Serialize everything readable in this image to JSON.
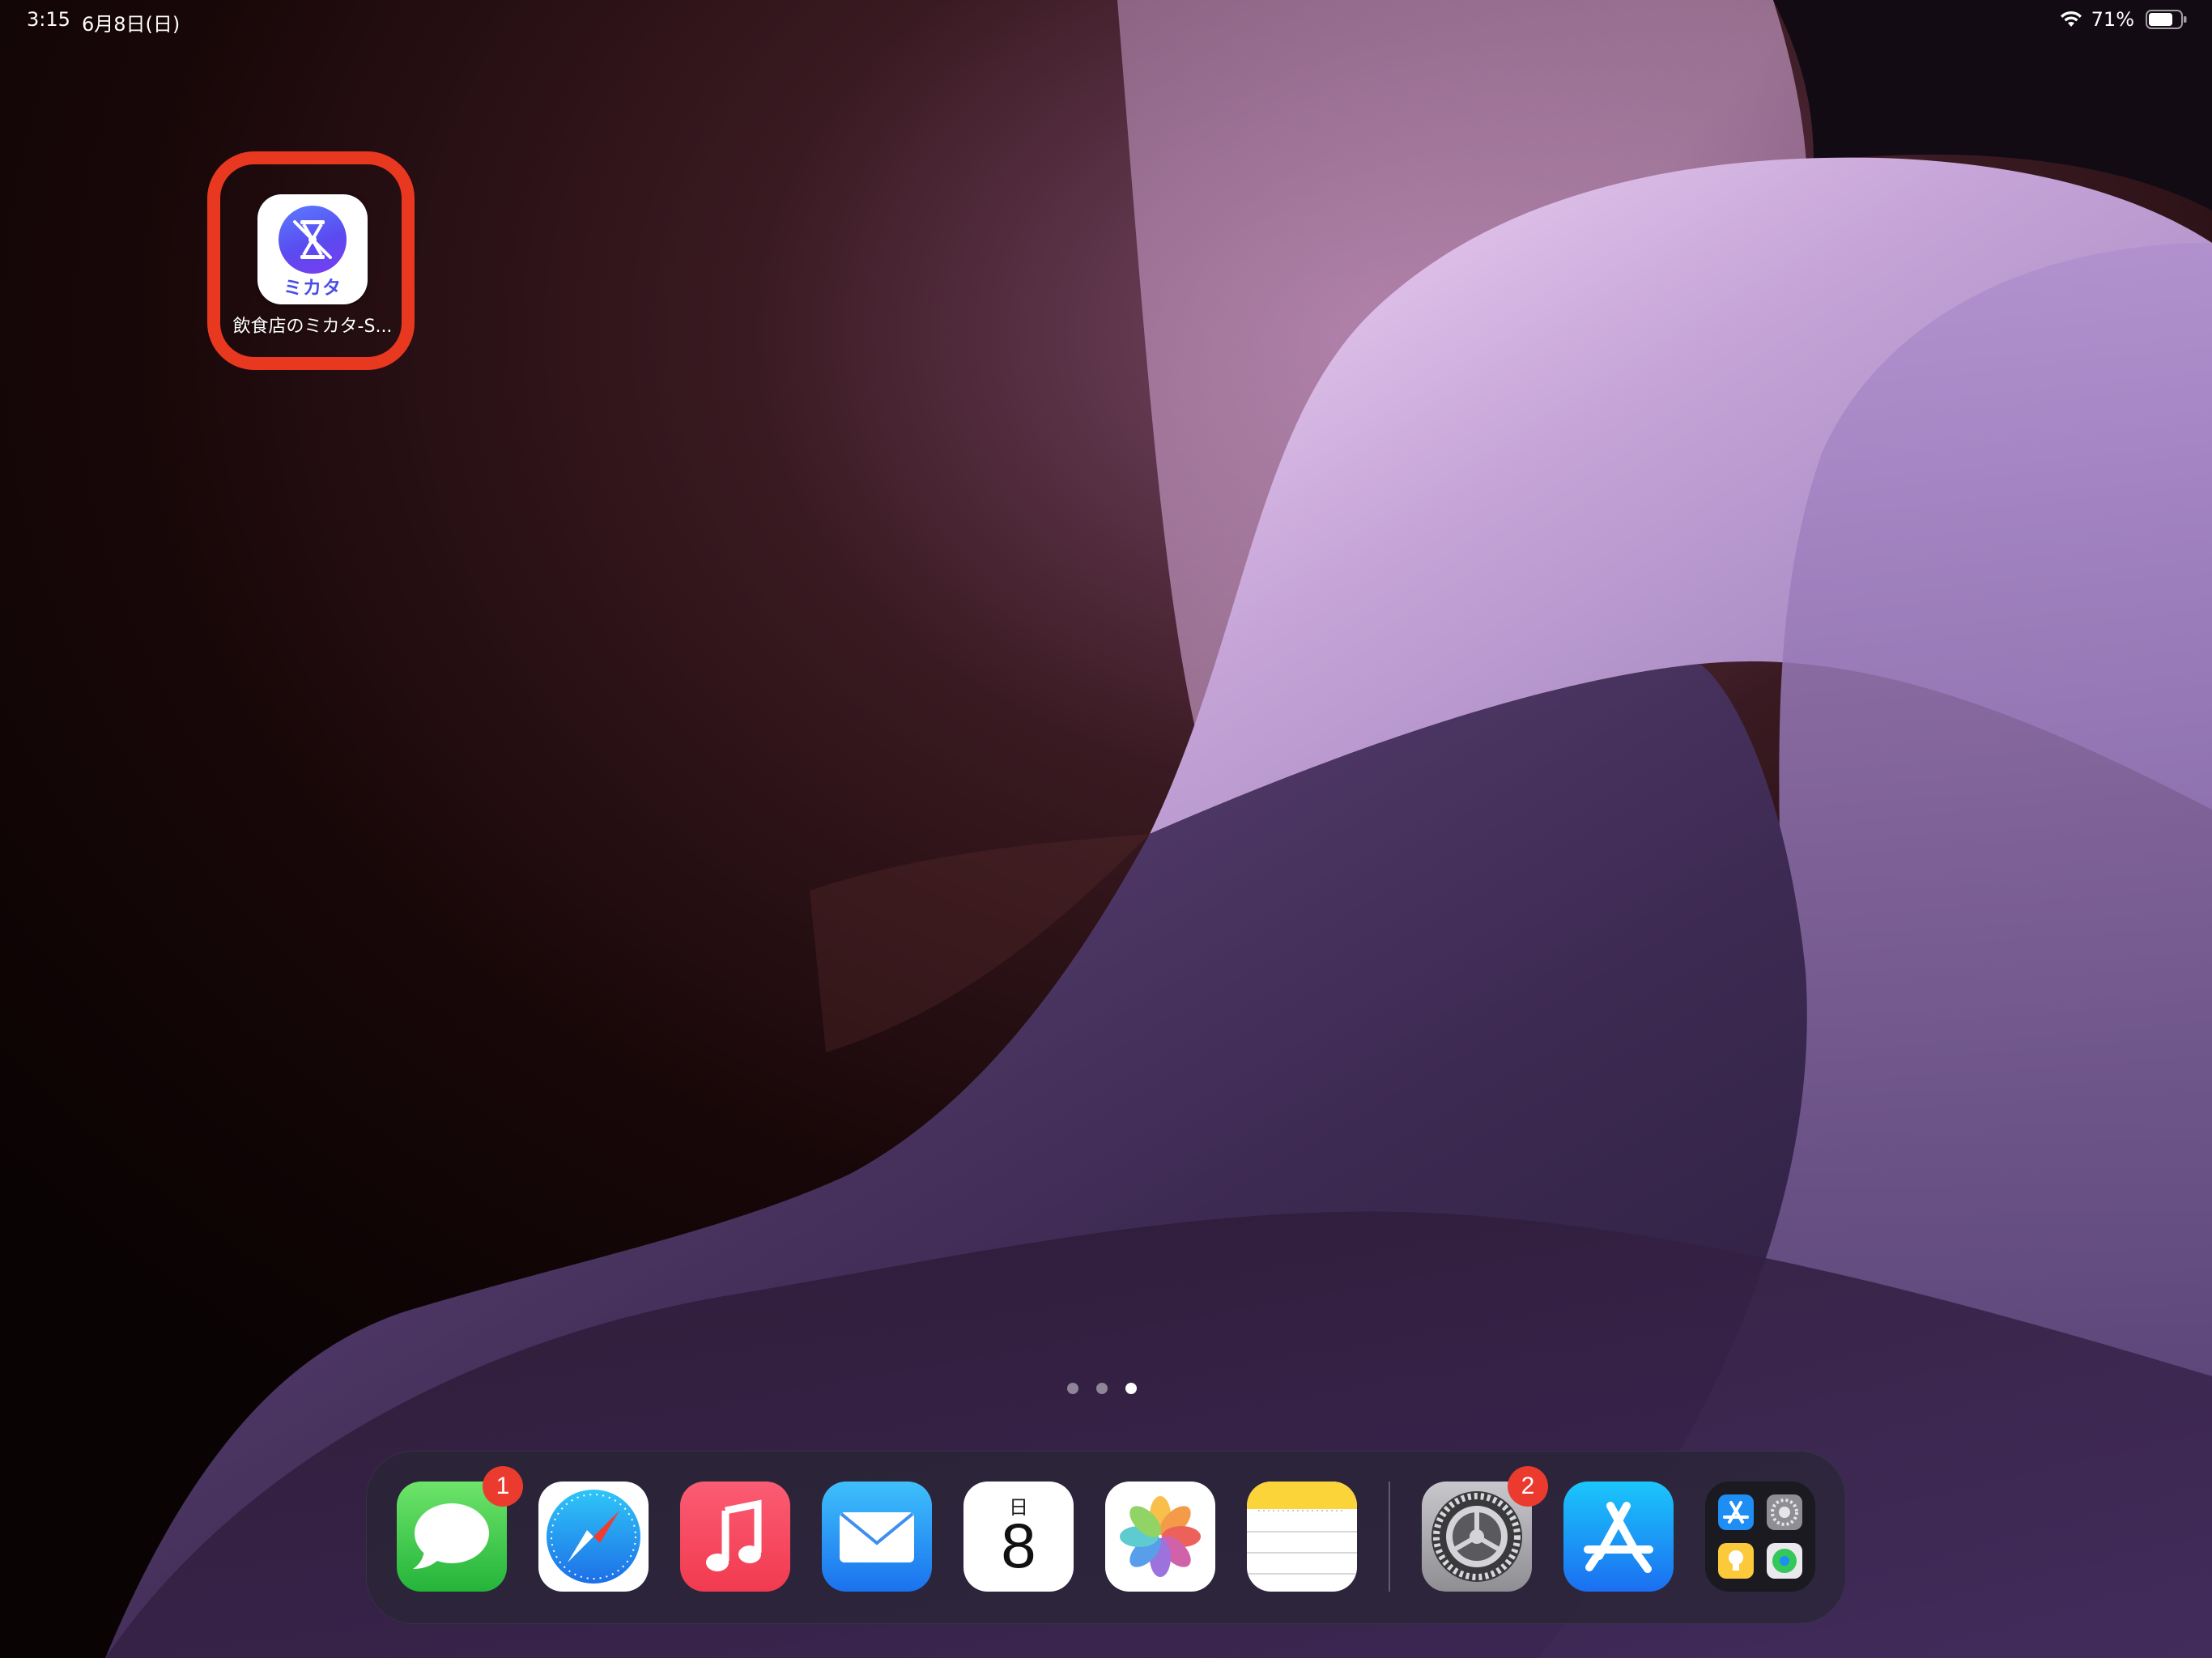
{
  "status_bar": {
    "time": "3:15",
    "date": "6月8日(日)",
    "battery_percent": "71%"
  },
  "home_screen": {
    "app": {
      "label": "飲食店のミカタ-S...",
      "icon_text": "ミカタ",
      "icon": "mikata-app-icon",
      "highlighted": true
    },
    "page_count": 3,
    "current_page": 3
  },
  "dock": {
    "apps": [
      {
        "name": "Messages",
        "icon": "messages-icon",
        "badge": "1"
      },
      {
        "name": "Safari",
        "icon": "safari-icon"
      },
      {
        "name": "Music",
        "icon": "music-icon"
      },
      {
        "name": "Mail",
        "icon": "mail-icon"
      },
      {
        "name": "Calendar",
        "icon": "calendar-icon",
        "day": "日",
        "date": "8"
      },
      {
        "name": "Photos",
        "icon": "photos-icon"
      },
      {
        "name": "Notes",
        "icon": "notes-icon"
      }
    ],
    "recent_apps": [
      {
        "name": "Settings",
        "icon": "settings-icon",
        "badge": "2"
      },
      {
        "name": "App Store",
        "icon": "app-store-icon"
      },
      {
        "name": "App Library",
        "icon": "app-library-icon"
      }
    ]
  },
  "colors": {
    "highlight": "#e8381f",
    "badge": "#eb3b2f",
    "mikata_brand": "#4a4ee8"
  }
}
